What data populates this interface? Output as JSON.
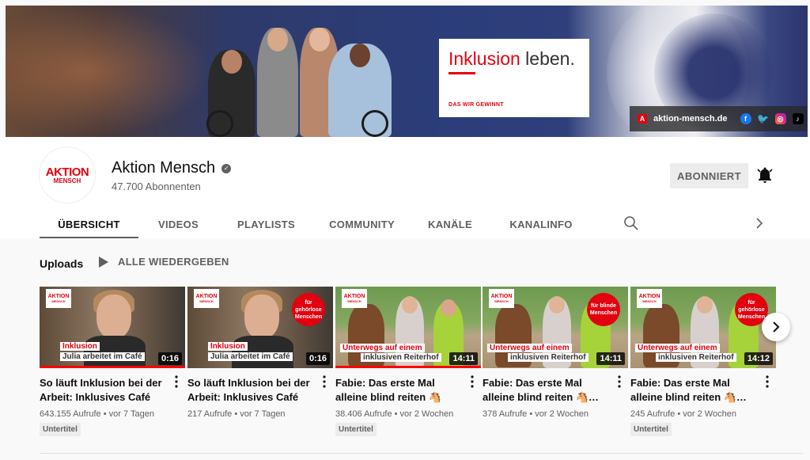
{
  "banner": {
    "headline_red": "Inklusion",
    "headline_dark": " leben.",
    "tagline": "DAS WIR GEWINNT",
    "website": "aktion-mensch.de",
    "social_icons": [
      "facebook-icon",
      "twitter-icon",
      "instagram-icon",
      "tiktok-icon"
    ]
  },
  "channel": {
    "avatar_line1": "AKTION",
    "avatar_line2": "MENSCH",
    "name": "Aktion Mensch",
    "subscribers": "47.700 Abonnenten",
    "subscribe_label": "ABONNIERT"
  },
  "tabs": [
    {
      "label": "ÜBERSICHT",
      "active": true
    },
    {
      "label": "VIDEOS",
      "active": false
    },
    {
      "label": "PLAYLISTS",
      "active": false
    },
    {
      "label": "COMMUNITY",
      "active": false
    },
    {
      "label": "KANÄLE",
      "active": false
    },
    {
      "label": "KANALINFO",
      "active": false
    }
  ],
  "section": {
    "title": "Uploads",
    "play_all": "ALLE WIEDERGEBEN"
  },
  "videos": [
    {
      "title": "So läuft Inklusion bei der Arbeit: Inklusives Café in…",
      "views": "643.155 Aufrufe",
      "age": "vor 7 Tagen",
      "duration": "0:16",
      "badge": "Untertitel",
      "thumb_caption_red": "Inklusion",
      "thumb_caption_dark": "Julia arbeitet im Café",
      "thumb_circle": "",
      "watched": true
    },
    {
      "title": "So läuft Inklusion bei der Arbeit: Inklusives Café in…",
      "views": "217 Aufrufe",
      "age": "vor 7 Tagen",
      "duration": "0:16",
      "badge": "",
      "thumb_caption_red": "Inklusion",
      "thumb_caption_dark": "Julia arbeitet im Café",
      "thumb_circle": "für gehörlose Menschen",
      "watched": false
    },
    {
      "title": "Fabie: Das erste Mal alleine blind reiten 🐴",
      "views": "38.406 Aufrufe",
      "age": "vor 2 Wochen",
      "duration": "14:11",
      "badge": "Untertitel",
      "thumb_caption_red": "Unterwegs auf einem",
      "thumb_caption_dark": "inklusiven Reiterhof",
      "thumb_circle": "",
      "watched": true
    },
    {
      "title": "Fabie: Das erste Mal alleine blind reiten 🐴…",
      "views": "378 Aufrufe",
      "age": "vor 2 Wochen",
      "duration": "14:11",
      "badge": "",
      "thumb_caption_red": "Unterwegs auf einem",
      "thumb_caption_dark": "inklusiven Reiterhof",
      "thumb_circle": "für blinde Menschen",
      "watched": false
    },
    {
      "title": "Fabie: Das erste Mal alleine blind reiten 🐴…",
      "views": "245 Aufrufe",
      "age": "vor 2 Wochen",
      "duration": "14:12",
      "badge": "Untertitel",
      "thumb_caption_red": "Unterwegs auf einem",
      "thumb_caption_dark": "inklusiven Reiterhof",
      "thumb_circle": "für gehörlose Menschen",
      "watched": false
    }
  ],
  "meta_separator": "•",
  "colors": {
    "brand_red": "#e3000f",
    "progress_red": "#ff0000",
    "text_primary": "#0f0f0f",
    "text_secondary": "#606060"
  }
}
